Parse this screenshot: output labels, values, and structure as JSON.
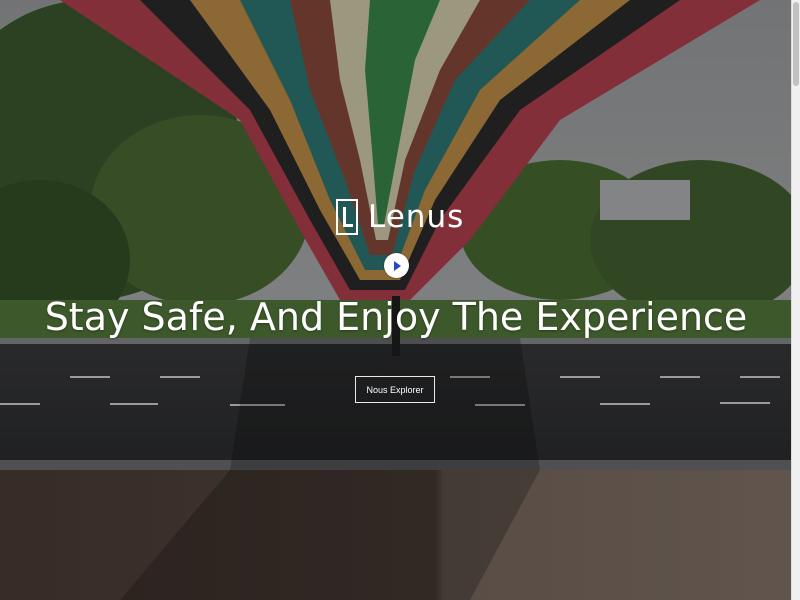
{
  "brand": {
    "name": "Lenus"
  },
  "hero": {
    "headline": "Stay Safe, And Enjoy The Experience",
    "cta_label": "Nous Explorer"
  },
  "icons": {
    "brand_mark": "lenus-logo-icon",
    "play": "play-icon"
  },
  "colors": {
    "play_accent": "#2b47c9",
    "text": "#ffffff"
  }
}
